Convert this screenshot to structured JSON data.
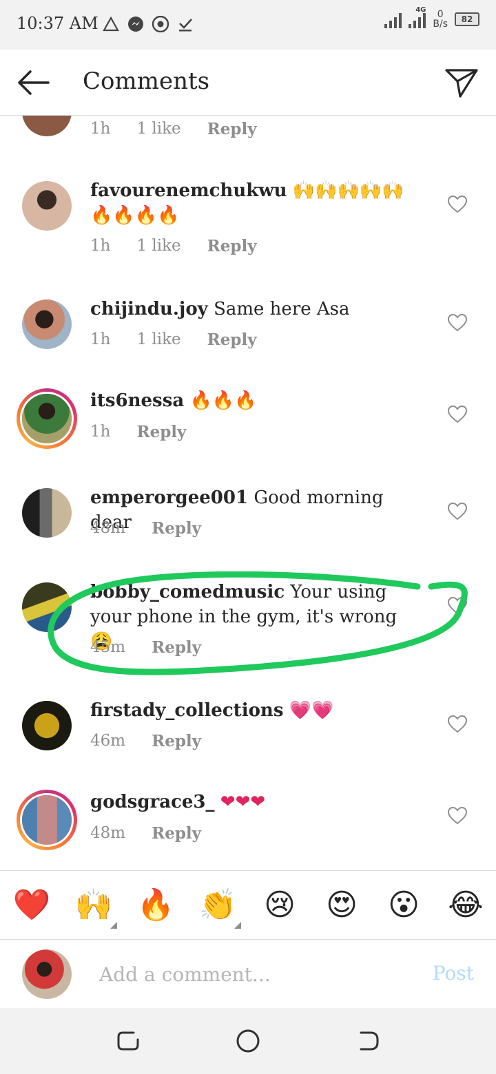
{
  "status_bar": {
    "time": "10:37 AM",
    "notif_icons": [
      "warning-triangle-icon",
      "messenger-icon",
      "chrome-icon",
      "download-done-icon"
    ],
    "network_label": "4G",
    "speed_value": "0",
    "speed_unit": "B/s",
    "battery": "82"
  },
  "header": {
    "title": "Comments",
    "back_icon": "back-arrow-icon",
    "share_icon": "direct-send-icon"
  },
  "partial_comment": {
    "time": "1h",
    "likes": "1 like",
    "reply": "Reply"
  },
  "comments": [
    {
      "username": "favourenemchukwu",
      "text": "🙌🙌🙌🙌🙌🔥🔥🔥🔥",
      "time": "1h",
      "likes": "1 like",
      "reply": "Reply",
      "story_ring": false,
      "avatar_color": "#caa08a"
    },
    {
      "username": "chijindu.joy",
      "text": "Same here Asa",
      "time": "1h",
      "likes": "1 like",
      "reply": "Reply",
      "story_ring": false,
      "avatar_color": "#b87f6a"
    },
    {
      "username": "its6nessa",
      "text": "🔥🔥🔥",
      "time": "1h",
      "likes": "",
      "reply": "Reply",
      "story_ring": true,
      "avatar_color": "#3f6f3f"
    },
    {
      "username": "emperorgee001",
      "text": "Good morning dear",
      "time": "48m",
      "likes": "",
      "reply": "Reply",
      "story_ring": false,
      "avatar_color": "#4a4a4a"
    },
    {
      "username": "bobby_comedmusic",
      "text": "Your using your phone in the gym, it's wrong 😩",
      "time": "45m",
      "likes": "",
      "reply": "Reply",
      "story_ring": false,
      "avatar_color": "#556b2f"
    },
    {
      "username": "firstady_collections",
      "text": "💗💗",
      "time": "46m",
      "likes": "",
      "reply": "Reply",
      "story_ring": false,
      "avatar_color": "#2b2b1a"
    },
    {
      "username": "godsgrace3_",
      "text": "❤❤❤",
      "time": "48m",
      "likes": "",
      "reply": "Reply",
      "story_ring": true,
      "avatar_color": "#6a8fb3"
    }
  ],
  "annotation": {
    "color": "#1fc95c"
  },
  "emoji_bar": [
    "❤️",
    "🙌",
    "🔥",
    "👏",
    "😢",
    "😍",
    "😮",
    "😂"
  ],
  "composer": {
    "placeholder": "Add a comment...",
    "post_label": "Post"
  },
  "nav_bar": [
    "recents-icon",
    "home-icon",
    "back-icon"
  ]
}
